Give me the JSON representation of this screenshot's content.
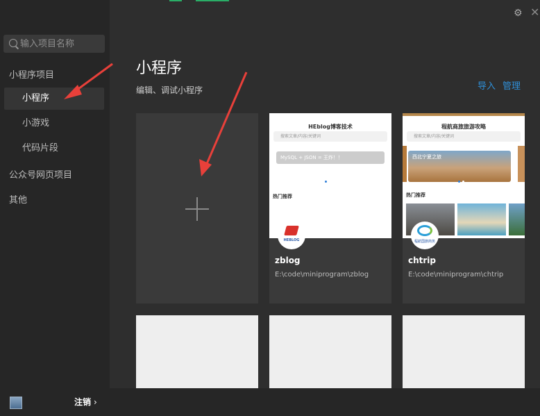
{
  "sidebar": {
    "search_placeholder": "输入项目名称",
    "groups": [
      {
        "label": "小程序项目",
        "items": [
          "小程序",
          "小游戏",
          "代码片段"
        ]
      },
      {
        "label": "公众号网页项目"
      },
      {
        "label": "其他"
      }
    ],
    "active": "小程序"
  },
  "footer": {
    "logout_label": "注销",
    "logout_chevron": "›"
  },
  "window": {
    "gear_icon": "⚙",
    "close_icon": "✕"
  },
  "main": {
    "title": "小程序",
    "subtitle": "编辑、调试小程序",
    "import_label": "导入",
    "manage_label": "管理"
  },
  "projects": [
    {
      "name": "zblog",
      "path": "E:\\code\\miniprogram\\zblog",
      "preview": {
        "title": "HEblog博客技术",
        "search": "搜索文章/内容/关键词",
        "banner": "MySQL + JSON = 王炸！！",
        "section": "热门推荐",
        "logo_text": "HEBLOG"
      }
    },
    {
      "name": "chtrip",
      "path": "E:\\code\\miniprogram\\chtrip",
      "preview": {
        "title": "程航商旅旅游攻略",
        "search": "搜索文章/内容/关键词",
        "banner": "西北宁夏之旅",
        "section": "热门推荐",
        "logo_text": "程航国旅商务"
      }
    }
  ],
  "colors": {
    "accent": "#2f8fd8",
    "arrow": "#e8403a",
    "topstrip_green": "#2aae67"
  }
}
